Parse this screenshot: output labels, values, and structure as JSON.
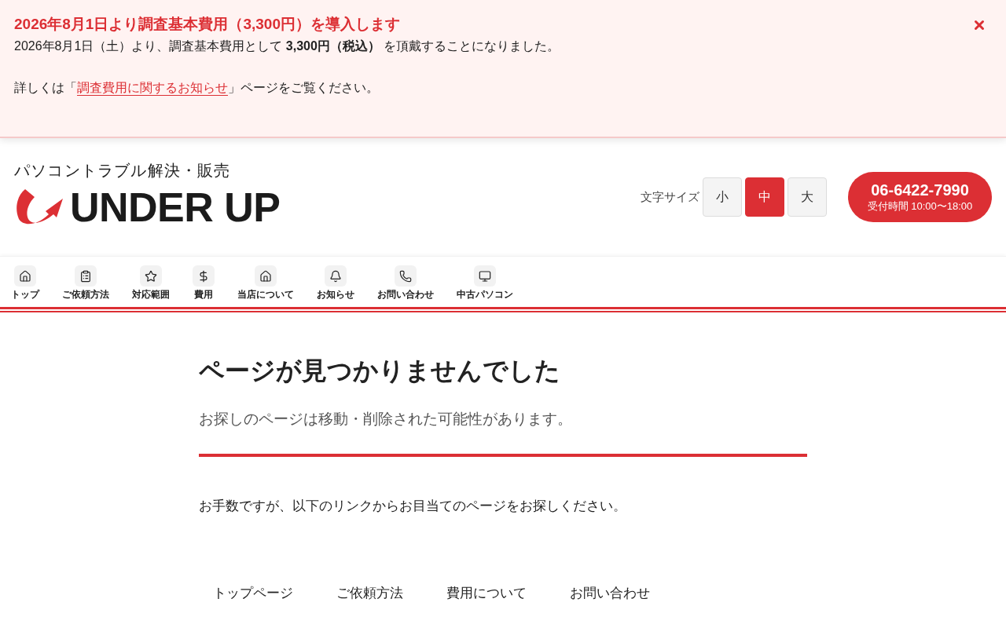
{
  "notice": {
    "title": "2026年8月1日より調査基本費用（3,300円）を導入します",
    "body": "2026年8月1日（土）より、調査基本費用として **3,300円（税込）** を頂戴することになりました。",
    "detail": {
      "before": "詳しくは「",
      "link": "調査費用に関するお知らせ",
      "after": "」ページをご覧ください。"
    }
  },
  "header": {
    "tagline": "パソコントラブル解決・販売",
    "logo_text": "UNDER UP",
    "font_size": {
      "label": "文字サイズ",
      "options": [
        {
          "label": "小",
          "selected": false
        },
        {
          "label": "中",
          "selected": true
        },
        {
          "label": "大",
          "selected": false
        }
      ]
    },
    "phone": {
      "number": "06-6422-7990",
      "hours": "受付時間 10:00〜18:00"
    }
  },
  "nav": [
    {
      "label": "トップ"
    },
    {
      "label": "ご依頼方法"
    },
    {
      "label": "対応範囲"
    },
    {
      "label": "費用"
    },
    {
      "label": "当店について"
    },
    {
      "label": "お知らせ"
    },
    {
      "label": "お問い合わせ"
    },
    {
      "label": "中古パソコン"
    }
  ],
  "main": {
    "title": "ページが見つかりませんでした",
    "subtitle": "お探しのページは移動・削除された可能性があります。",
    "message": "お手数ですが、以下のリンクからお目当てのページをお探しください。",
    "links": [
      "トップページ",
      "ご依頼方法",
      "費用について",
      "お問い合わせ"
    ]
  }
}
